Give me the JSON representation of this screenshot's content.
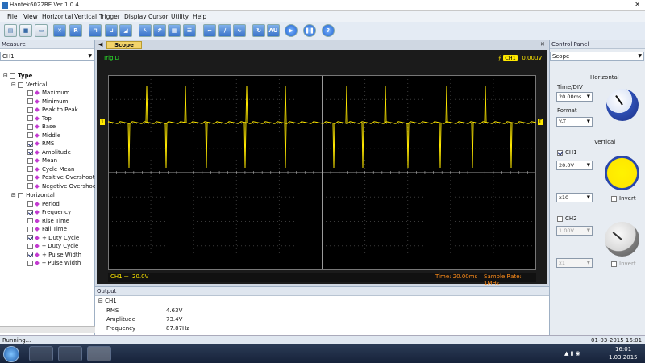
{
  "window": {
    "title": "Hantek6022BE Ver 1.0.4"
  },
  "menu": [
    "File",
    "View",
    "Horizontal",
    "Vertical",
    "Trigger",
    "Display",
    "Cursor",
    "Utility",
    "Help"
  ],
  "toolbar": {
    "buttons": [
      {
        "icon": "open-icon",
        "glyph": "▤"
      },
      {
        "icon": "save-icon",
        "glyph": "■"
      },
      {
        "icon": "print-icon",
        "glyph": "▭"
      },
      {
        "icon": "autoset-icon",
        "glyph": "✕"
      },
      {
        "icon": "run-r-icon",
        "glyph": "R"
      },
      {
        "icon": "pulse-rise-icon",
        "glyph": "⊓"
      },
      {
        "icon": "pulse-fall-icon",
        "glyph": "⊔"
      },
      {
        "icon": "ramp-icon",
        "glyph": "◢"
      },
      {
        "icon": "cursor-icon",
        "glyph": "↖"
      },
      {
        "icon": "grid-icon",
        "glyph": "#"
      },
      {
        "icon": "grid-fine-icon",
        "glyph": "▦"
      },
      {
        "icon": "lines-icon",
        "glyph": "☰"
      },
      {
        "icon": "wave-step-icon",
        "glyph": "⌐"
      },
      {
        "icon": "wave-line-icon",
        "glyph": "∕"
      },
      {
        "icon": "wave-sine-icon",
        "glyph": "∿"
      },
      {
        "icon": "refresh-icon",
        "glyph": "↻"
      },
      {
        "icon": "auto-icon",
        "glyph": "AU"
      },
      {
        "icon": "play-icon",
        "glyph": "▶"
      },
      {
        "icon": "pause-icon",
        "glyph": "❚❚"
      },
      {
        "icon": "help-icon",
        "glyph": "?"
      }
    ]
  },
  "measure": {
    "title": "Measure",
    "channel": "CH1",
    "root": "Type",
    "vertical_label": "Vertical",
    "vertical": [
      {
        "label": "Maximum",
        "checked": false
      },
      {
        "label": "Minimum",
        "checked": false
      },
      {
        "label": "Peak to Peak",
        "checked": false
      },
      {
        "label": "Top",
        "checked": false
      },
      {
        "label": "Base",
        "checked": false
      },
      {
        "label": "Middle",
        "checked": false
      },
      {
        "label": "RMS",
        "checked": true
      },
      {
        "label": "Amplitude",
        "checked": true
      },
      {
        "label": "Mean",
        "checked": false
      },
      {
        "label": "Cycle Mean",
        "checked": false
      },
      {
        "label": "Positive Overshoot",
        "checked": false
      },
      {
        "label": "Negative Overshoot",
        "checked": false
      }
    ],
    "horizontal_label": "Horizontal",
    "horizontal": [
      {
        "label": "Period",
        "checked": false
      },
      {
        "label": "Frequency",
        "checked": true
      },
      {
        "label": "Rise Time",
        "checked": false
      },
      {
        "label": "Fall Time",
        "checked": false
      },
      {
        "label": "+ Duty Cycle",
        "checked": true
      },
      {
        "label": "-- Duty Cycle",
        "checked": false
      },
      {
        "label": "+ Pulse Width",
        "checked": true
      },
      {
        "label": "-- Pulse Width",
        "checked": false
      }
    ]
  },
  "scope": {
    "tab": "Scope",
    "trig_status": "Trig'D",
    "trigger_channel": "CH1",
    "trigger_level": "0.00uV",
    "ch_readout_label": "CH1 ⎓",
    "ch_readout_value": "20.0V",
    "time": "Time: 20.00ms",
    "sample_rate": "Sample Rate: 1MHz",
    "trace_color": "#ffe800"
  },
  "control": {
    "title": "Control Panel",
    "mode": "Scope",
    "horizontal_label": "Horizontal",
    "timediv_label": "Time/DIV",
    "timediv": "20.00ms",
    "format_label": "Format",
    "format": "Y-T",
    "vertical_label": "Vertical",
    "ch1_label": "CH1",
    "ch1_volts": "20.0V",
    "ch1_probe": "x10",
    "ch1_invert": "Invert",
    "ch2_label": "CH2",
    "ch2_volts": "1.00V",
    "ch2_probe": "x1",
    "ch2_invert": "Invert"
  },
  "output": {
    "title": "Output",
    "channel": "CH1",
    "rows": [
      {
        "name": "RMS",
        "value": "4.63V"
      },
      {
        "name": "Amplitude",
        "value": "73.4V"
      },
      {
        "name": "Frequency",
        "value": "87.87Hz"
      }
    ]
  },
  "status": {
    "left": "Running...",
    "right": "01-03-2015 16:01"
  },
  "taskbar": {
    "time": "16:01",
    "date": "1.03.2015"
  }
}
